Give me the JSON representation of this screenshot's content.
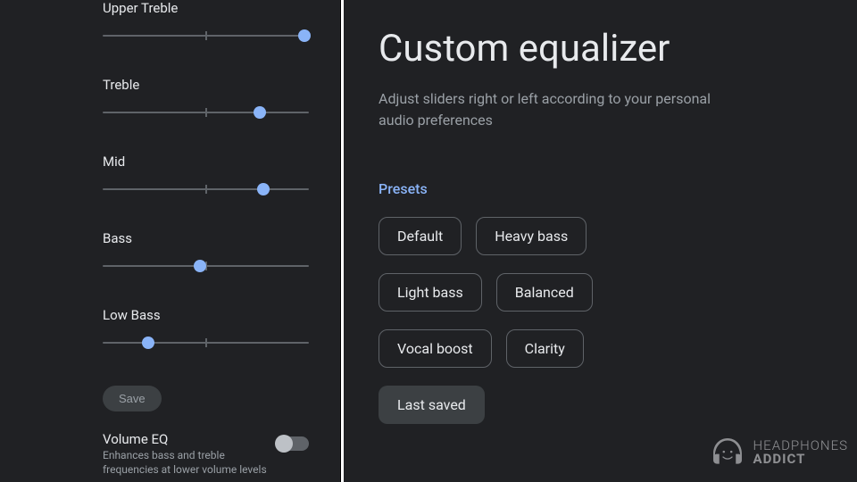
{
  "left": {
    "sliders": [
      {
        "label": "Upper Treble",
        "value": 98
      },
      {
        "label": "Treble",
        "value": 76
      },
      {
        "label": "Mid",
        "value": 78
      },
      {
        "label": "Bass",
        "value": 47
      },
      {
        "label": "Low Bass",
        "value": 22
      }
    ],
    "save_label": "Save",
    "volume_eq": {
      "title": "Volume EQ",
      "subtitle": "Enhances bass and treble frequencies at lower volume levels",
      "enabled": false
    }
  },
  "right": {
    "title": "Custom equalizer",
    "subtitle": "Adjust sliders right or left according to your personal audio preferences",
    "presets_label": "Presets",
    "presets": [
      {
        "label": "Default",
        "active": false
      },
      {
        "label": "Heavy bass",
        "active": false
      },
      {
        "label": "Light bass",
        "active": false
      },
      {
        "label": "Balanced",
        "active": false
      },
      {
        "label": "Vocal boost",
        "active": false
      },
      {
        "label": "Clarity",
        "active": false
      },
      {
        "label": "Last saved",
        "active": true
      }
    ]
  },
  "watermark": {
    "top": "HEADPHONES",
    "bottom": "ADDICT"
  }
}
